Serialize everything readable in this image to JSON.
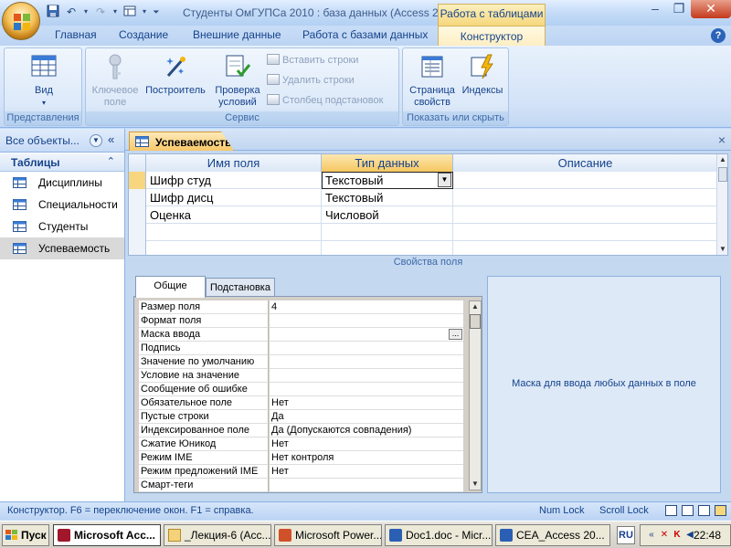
{
  "titlebar": {
    "title": "Студенты ОмГУПСа 2010 : база данных (Access 2... M",
    "context_tab": "Работа с таблицами"
  },
  "ribbon_tabs": {
    "home": "Главная",
    "create": "Создание",
    "external": "Внешние данные",
    "database_tools": "Работа с базами данных",
    "design": "Конструктор"
  },
  "ribbon": {
    "groups": {
      "views": "Представления",
      "tools": "Сервис",
      "show_hide": "Показать или скрыть"
    },
    "view_label": "Вид",
    "primary_key_line1": "Ключевое",
    "primary_key_line2": "поле",
    "builder": "Построитель",
    "test_rules_line1": "Проверка",
    "test_rules_line2": "условий",
    "insert_rows": "Вставить строки",
    "delete_rows": "Удалить строки",
    "lookup_column": "Столбец  подстановок",
    "property_sheet_line1": "Страница",
    "property_sheet_line2": "свойств",
    "indexes": "Индексы"
  },
  "nav": {
    "title": "Все объекты...",
    "section": "Таблицы",
    "items": [
      {
        "label": "Дисциплины"
      },
      {
        "label": "Специальности"
      },
      {
        "label": "Студенты"
      },
      {
        "label": "Успеваемость"
      }
    ]
  },
  "document": {
    "tab_label": "Успеваемость",
    "columns": {
      "field_name": "Имя поля",
      "data_type": "Тип данных",
      "description": "Описание"
    },
    "rows": [
      {
        "name": "Шифр студ",
        "type": "Текстовый",
        "description": ""
      },
      {
        "name": "Шифр дисц",
        "type": "Текстовый",
        "description": ""
      },
      {
        "name": "Оценка",
        "type": "Числовой",
        "description": ""
      }
    ],
    "field_properties_label": "Свойства поля"
  },
  "properties": {
    "tab_general": "Общие",
    "tab_lookup": "Подстановка",
    "rows": [
      {
        "label": "Размер поля",
        "value": "4"
      },
      {
        "label": "Формат поля",
        "value": ""
      },
      {
        "label": "Маска ввода",
        "value": ""
      },
      {
        "label": "Подпись",
        "value": ""
      },
      {
        "label": "Значение по умолчанию",
        "value": ""
      },
      {
        "label": "Условие на значение",
        "value": ""
      },
      {
        "label": "Сообщение об ошибке",
        "value": ""
      },
      {
        "label": "Обязательное поле",
        "value": "Нет"
      },
      {
        "label": "Пустые строки",
        "value": "Да"
      },
      {
        "label": "Индексированное поле",
        "value": "Да (Допускаются совпадения)"
      },
      {
        "label": "Сжатие Юникод",
        "value": "Нет"
      },
      {
        "label": "Режим IME",
        "value": "Нет контроля"
      },
      {
        "label": "Режим предложений IME",
        "value": "Нет"
      },
      {
        "label": "Смарт-теги",
        "value": ""
      }
    ],
    "hint": "Маска для ввода любых данных в поле"
  },
  "statusbar": {
    "text": "Конструктор.  F6 = переключение окон.  F1 = справка.",
    "numlock": "Num Lock",
    "scrolllock": "Scroll Lock"
  },
  "taskbar": {
    "start": "Пуск",
    "items": [
      {
        "label": "Microsoft Acc..."
      },
      {
        "label": "_Лекция-6 (Acc..."
      },
      {
        "label": "Microsoft Power..."
      },
      {
        "label": "Doc1.doc - Micr..."
      },
      {
        "label": "CEA_Access 20..."
      }
    ],
    "lang": "RU",
    "clock": "22:48"
  },
  "colors": {
    "accent": "#15428b",
    "context_tab": "#f6d77c",
    "ribbon_bg": "#d4e3f8"
  }
}
